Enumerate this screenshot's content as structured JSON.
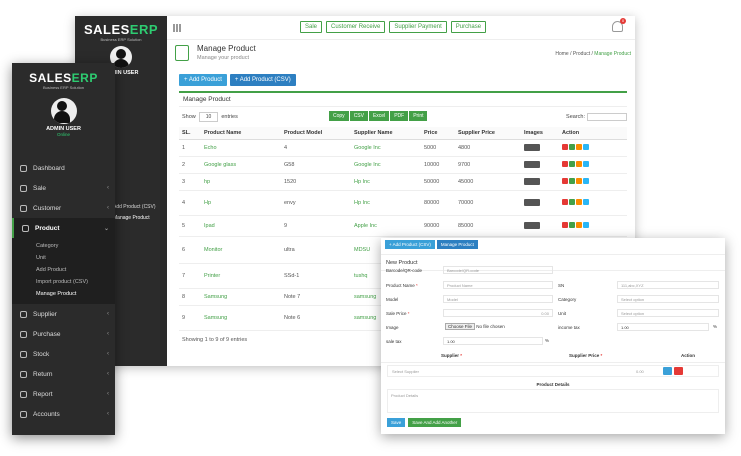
{
  "brand": {
    "logo_main": "SALES",
    "logo_accent": "ERP",
    "tagline": "Business ERP Solution"
  },
  "back": {
    "sidebar": {
      "user_name": "ADMIN USER",
      "visible_items": [
        "Add Product (CSV)",
        "Manage Product"
      ]
    },
    "quick_buttons": [
      "Sale",
      "Customer Receive",
      "Supplier Payment",
      "Purchase"
    ],
    "notification_count": "0",
    "page_title": "Manage Product",
    "page_subtitle": "Manage your product",
    "breadcrumb": {
      "home": "Home",
      "sep": "/",
      "section": "Product",
      "current": "Manage Product"
    },
    "action_buttons": {
      "add_product": "+ Add Product",
      "add_product_csv": "+ Add Product (CSV)"
    },
    "panel_title": "Manage Product",
    "show_label": "Show",
    "show_value": "10",
    "entries_label": "entries",
    "export_buttons": [
      "Copy",
      "CSV",
      "Excel",
      "PDF",
      "Print"
    ],
    "search_label": "Search:",
    "table": {
      "headers": [
        "SL.",
        "Product Name",
        "Product Model",
        "Supplier Name",
        "Price",
        "Supplier Price",
        "Images",
        "Action"
      ],
      "rows": [
        [
          "1",
          "Echo",
          "4",
          "Google Inc",
          "5000",
          "4800"
        ],
        [
          "2",
          "Google glass",
          "G58",
          "Google Inc",
          "10000",
          "9700"
        ],
        [
          "3",
          "hp",
          "1520",
          "Hp Inc",
          "50000",
          "45000"
        ],
        [
          "4",
          "Hp",
          "envy",
          "Hp Inc",
          "80000",
          "70000"
        ],
        [
          "5",
          "Ipad",
          "9",
          "Apple Inc",
          "90000",
          "85000"
        ],
        [
          "6",
          "Monitor",
          "ultra",
          "MDSU",
          "",
          ""
        ],
        [
          "7",
          "Printer",
          "SSd-1",
          "tushq",
          "",
          ""
        ],
        [
          "8",
          "Samsung",
          "Note 7",
          "samsung",
          "",
          ""
        ],
        [
          "9",
          "Samsung",
          "Note 6",
          "samsung",
          "",
          ""
        ]
      ]
    },
    "showing": "Showing 1 to 9 of 9 entries"
  },
  "front_sidebar": {
    "user_name": "ADMIN USER",
    "status": "Online",
    "menu": [
      "Dashboard",
      "Sale",
      "Customer",
      "Product",
      "Supplier",
      "Purchase",
      "Stock",
      "Return",
      "Report",
      "Accounts"
    ],
    "product_sub": [
      "Category",
      "Unit",
      "Add Product",
      "Import product (CSV)",
      "Manage Product"
    ]
  },
  "modal": {
    "top_buttons": [
      "+ Add Product (CSV)",
      "Manage Product"
    ],
    "title": "New Product",
    "labels": {
      "barcode": "Barcode/QR-code",
      "product_name": "Product Name",
      "model": "Model",
      "sale_price": "Sale Price",
      "image": "Image",
      "sale_tax": "sale tax",
      "sn": "SN",
      "category": "Category",
      "unit": "Unit",
      "income_tax": "income tax",
      "supplier": "Supplier",
      "supplier_price": "Supplier Price",
      "action": "Action",
      "product_details": "Product Details",
      "required": "*"
    },
    "placeholders": {
      "barcode": "Barcode/QR-code",
      "product_name": "Product Name",
      "model": "Model",
      "sale_price": "0.00",
      "sn": "111,abc,XYZ",
      "category": "Select option",
      "unit": "Select option",
      "select_supplier": "Select Supplier",
      "supplier_price": "0.00",
      "product_details": "Product Details"
    },
    "values": {
      "sale_tax": "1.00",
      "income_tax": "1.00",
      "sale_tax_unit": "%",
      "income_tax_unit": "%"
    },
    "file": {
      "button": "Choose File",
      "status": "No file chosen"
    },
    "footer_buttons": [
      "Save",
      "Save And Add Another"
    ]
  },
  "colors": {
    "accent": "#43a047",
    "primary": "#3aa0d8",
    "sidebar": "#2b2b2b",
    "danger": "#e53935"
  }
}
